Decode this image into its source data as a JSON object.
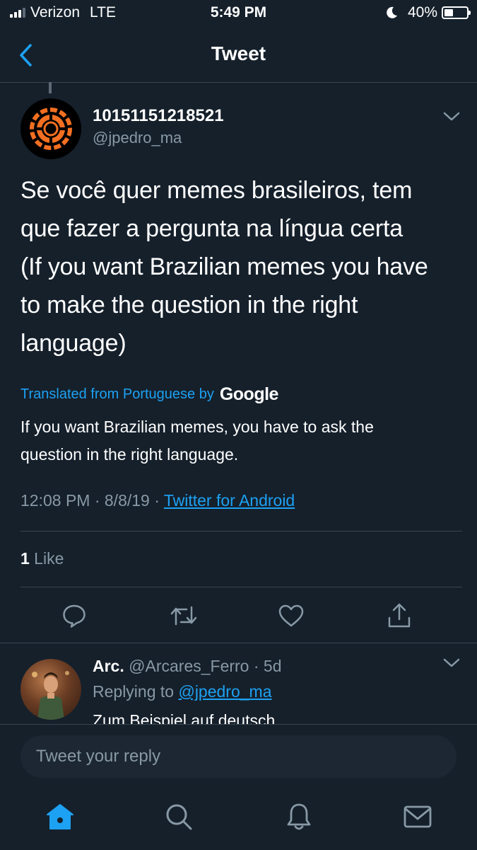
{
  "status_bar": {
    "carrier": "Verizon",
    "network": "LTE",
    "time": "5:49 PM",
    "battery": "40%",
    "battery_level": 0.4,
    "signal_bars": 3
  },
  "header": {
    "title": "Tweet"
  },
  "tweet": {
    "display_name": "10151151218521",
    "handle": "@jpedro_ma",
    "text_lines": [
      "Se você quer memes brasileiros, tem",
      "que fazer a pergunta na língua certa",
      "(If you want Brazilian memes you have",
      "to make the question in the right",
      "language)"
    ],
    "translated_label": "Translated from Portuguese by",
    "translator": "Google",
    "translation_lines": [
      "If you want Brazilian memes, you have to ask the",
      "question in the right language."
    ],
    "timestamp": "12:08 PM · 8/8/19 · ",
    "source": "Twitter for Android",
    "likes_count": "1",
    "likes_label": " Like"
  },
  "reply": {
    "display_name": "Arc.",
    "handle_time": " @Arcares_Ferro · 5d",
    "replying_prefix": "Replying to ",
    "replying_to": "@jpedro_ma",
    "text": "Zum Beispiel auf deutsch"
  },
  "composer": {
    "placeholder": "Tweet your reply"
  },
  "colors": {
    "background": "#15202b",
    "accent": "#1da1f2",
    "secondary_text": "#8899a6",
    "divider": "#38444d"
  },
  "icons": {
    "back": "chevron-left-icon",
    "caret": "chevron-down-icon",
    "reply": "speech-bubble-icon",
    "retweet": "retweet-icon",
    "like": "heart-icon",
    "share": "share-icon",
    "tabs": [
      "home-icon",
      "search-icon",
      "bell-icon",
      "mail-icon"
    ]
  }
}
